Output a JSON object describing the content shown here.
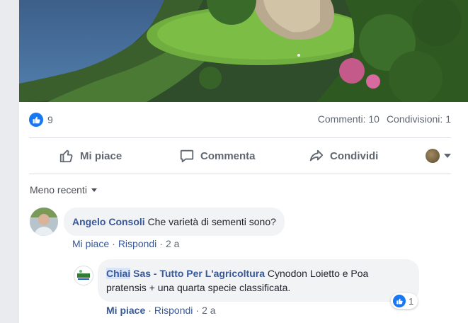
{
  "post": {
    "reaction_count": "9",
    "comments_label": "Commenti: 10",
    "shares_label": "Condivisioni: 1"
  },
  "actions": {
    "like": "Mi piace",
    "comment": "Commenta",
    "share": "Condividi"
  },
  "sort": {
    "label": "Meno recenti"
  },
  "comments": [
    {
      "author": "Angelo Consoli",
      "text": "Che varietà di sementi sono?",
      "like": "Mi piace",
      "reply": "Rispondi",
      "sep": "·",
      "time": "2 a"
    }
  ],
  "reply": {
    "author_highlight": "Chiai",
    "author_rest": " Sas - Tutto Per L'agricoltura",
    "text": " Cynodon Loietto e Poa pratensis + una quarta specie classificata.",
    "like": "Mi piace",
    "reply": "Rispondi",
    "sep": "·",
    "time": "2 a",
    "reaction_count": "1"
  },
  "colors": {
    "accent": "#1877f2",
    "link": "#385898",
    "muted": "#606770"
  }
}
